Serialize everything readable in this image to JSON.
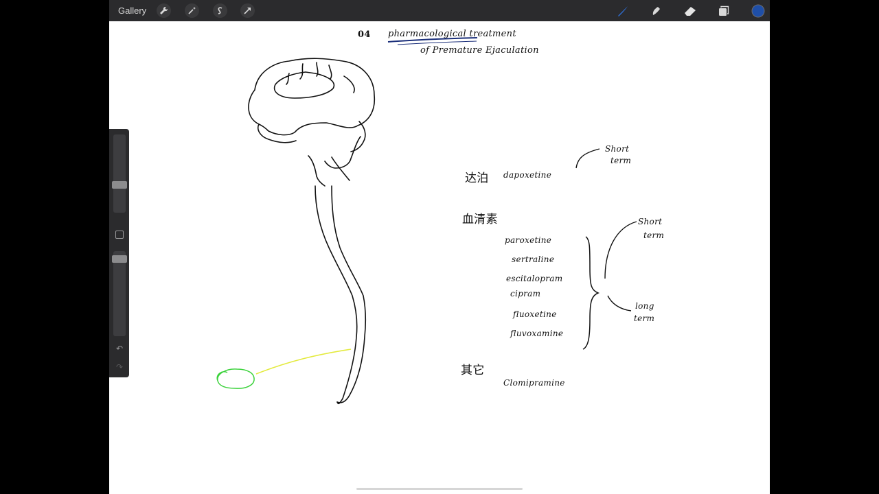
{
  "topbar": {
    "gallery_label": "Gallery",
    "left_tools": [
      "wrench-icon",
      "magic-wand-icon",
      "selection-icon",
      "transform-arrow-icon"
    ],
    "right_tools": [
      "brush-icon",
      "smudge-icon",
      "eraser-icon",
      "layers-icon",
      "color-swatch-icon"
    ],
    "accent_color": "#2f6fd6",
    "active_color": "#1f4fa8"
  },
  "sidebar": {
    "controls": [
      "brush-size-slider",
      "modify-button",
      "opacity-slider",
      "undo-button",
      "redo-button"
    ],
    "undo_glyph": "↶",
    "redo_glyph": "↷"
  },
  "notes": {
    "heading_number": "04",
    "heading_line1": "pharmacological treatment",
    "heading_line2": "of Premature Ejaculation",
    "dapoxetine_prefix": "达泊",
    "dapoxetine": "dapoxetine",
    "dapoxetine_duration": [
      "Short",
      "term"
    ],
    "ssri_label": "血清素",
    "ssri_drugs": [
      "paroxetine",
      "sertraline",
      "escitalopram",
      "cipram",
      "fluoxetine",
      "fluvoxamine"
    ],
    "ssri_short": [
      "Short",
      "term"
    ],
    "ssri_long": [
      "long",
      "term"
    ],
    "other_label": "其它",
    "other_drug": "Clomipramine"
  },
  "colors": {
    "ink": "#111111",
    "title_underline": "#1b2f7a",
    "nerve_line": "#e3ea3c",
    "organ_outline": "#3bd23b"
  }
}
